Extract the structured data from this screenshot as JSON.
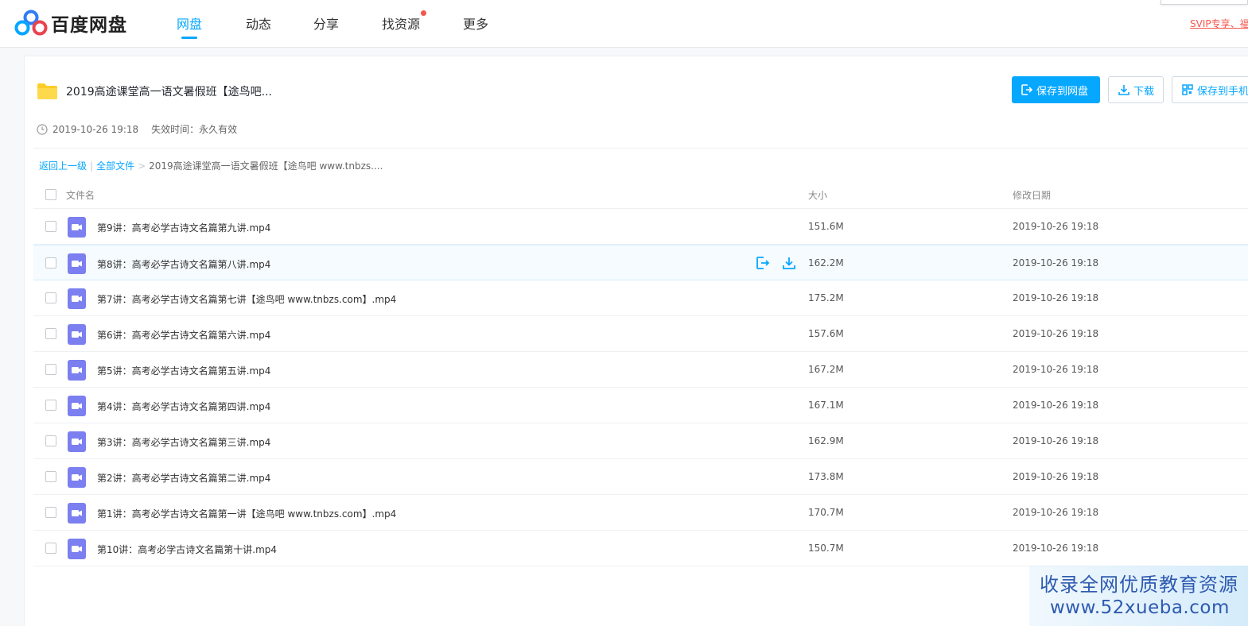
{
  "header": {
    "logo_text": "百度网盘",
    "nav": [
      {
        "label": "网盘",
        "active": true
      },
      {
        "label": "动态"
      },
      {
        "label": "分享"
      },
      {
        "label": "找资源",
        "has_dot": true
      },
      {
        "label": "更多"
      }
    ],
    "svip_link": "SVIP专享、福"
  },
  "share": {
    "title": "2019高途课堂高一语文暑假班【途鸟吧...",
    "created": "2019-10-26 19:18",
    "expire_label": "失效时间：永久有效",
    "buttons": {
      "save_to_netdisk": "保存到网盘",
      "download": "下载",
      "save_to_phone": "保存到手机"
    }
  },
  "breadcrumb": {
    "back": "返回上一级",
    "all_files": "全部文件",
    "current": "2019高途课堂高一语文暑假班【途鸟吧 www.tnbzs...."
  },
  "table": {
    "headers": {
      "name": "文件名",
      "size": "大小",
      "date": "修改日期"
    },
    "rows": [
      {
        "name": "第9讲：高考必学古诗文名篇第九讲.mp4",
        "size": "151.6M",
        "date": "2019-10-26 19:18"
      },
      {
        "name": "第8讲：高考必学古诗文名篇第八讲.mp4",
        "size": "162.2M",
        "date": "2019-10-26 19:18"
      },
      {
        "name": "第7讲：高考必学古诗文名篇第七讲【途鸟吧 www.tnbzs.com】.mp4",
        "size": "175.2M",
        "date": "2019-10-26 19:18"
      },
      {
        "name": "第6讲：高考必学古诗文名篇第六讲.mp4",
        "size": "157.6M",
        "date": "2019-10-26 19:18"
      },
      {
        "name": "第5讲：高考必学古诗文名篇第五讲.mp4",
        "size": "167.2M",
        "date": "2019-10-26 19:18"
      },
      {
        "name": "第4讲：高考必学古诗文名篇第四讲.mp4",
        "size": "167.1M",
        "date": "2019-10-26 19:18"
      },
      {
        "name": "第3讲：高考必学古诗文名篇第三讲.mp4",
        "size": "162.9M",
        "date": "2019-10-26 19:18"
      },
      {
        "name": "第2讲：高考必学古诗文名篇第二讲.mp4",
        "size": "173.8M",
        "date": "2019-10-26 19:18"
      },
      {
        "name": "第1讲：高考必学古诗文名篇第一讲【途鸟吧 www.tnbzs.com】.mp4",
        "size": "170.7M",
        "date": "2019-10-26 19:18"
      },
      {
        "name": "第10讲：高考必学古诗文名篇第十讲.mp4",
        "size": "150.7M",
        "date": "2019-10-26 19:18"
      }
    ]
  },
  "watermark": {
    "line1": "收录全网优质教育资源",
    "line2": "www.52xueba.com"
  },
  "colors": {
    "accent": "#06a7ff",
    "video_icon": "#7b7ff0",
    "folder": "#ffcd29",
    "alert": "#f4564d"
  }
}
